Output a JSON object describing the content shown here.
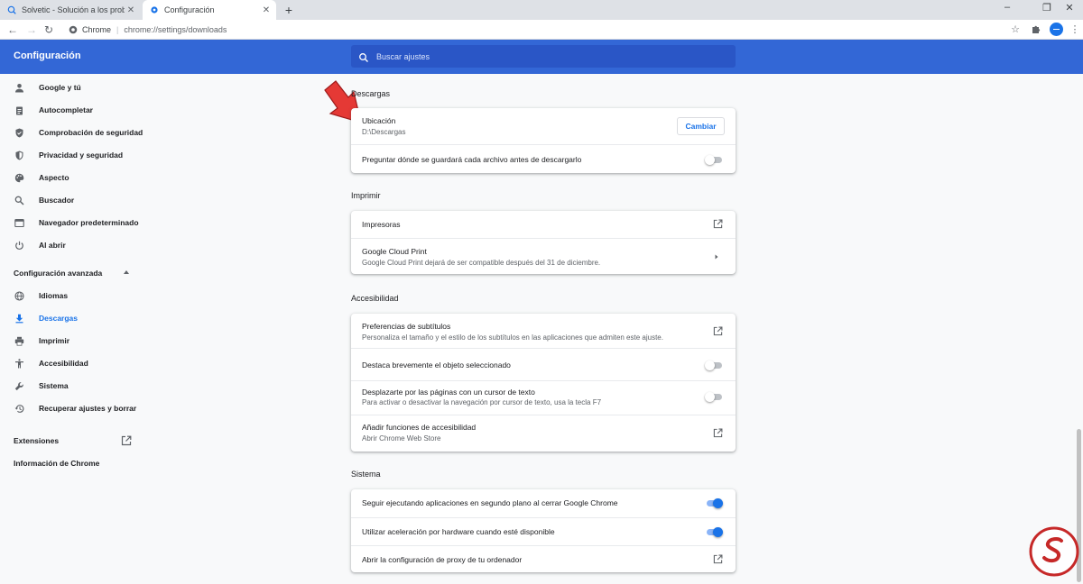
{
  "browser": {
    "tabs": [
      {
        "title": "Solvetic - Solución a los problem",
        "active": false
      },
      {
        "title": "Configuración",
        "active": true
      }
    ],
    "omnibox": {
      "site": "Chrome",
      "url": "chrome://settings/downloads"
    }
  },
  "header": {
    "title": "Configuración",
    "search_placeholder": "Buscar ajustes"
  },
  "sidebar": {
    "items": [
      {
        "label": "Google y tú",
        "icon": "person-icon"
      },
      {
        "label": "Autocompletar",
        "icon": "clipboard-icon"
      },
      {
        "label": "Comprobación de seguridad",
        "icon": "shield-check-icon"
      },
      {
        "label": "Privacidad y seguridad",
        "icon": "shield-icon"
      },
      {
        "label": "Aspecto",
        "icon": "palette-icon"
      },
      {
        "label": "Buscador",
        "icon": "search-icon"
      },
      {
        "label": "Navegador predeterminado",
        "icon": "browser-icon"
      },
      {
        "label": "Al abrir",
        "icon": "power-icon"
      }
    ],
    "advanced_label": "Configuración avanzada",
    "advanced_items": [
      {
        "label": "Idiomas",
        "icon": "globe-icon"
      },
      {
        "label": "Descargas",
        "icon": "download-icon"
      },
      {
        "label": "Imprimir",
        "icon": "printer-icon"
      },
      {
        "label": "Accesibilidad",
        "icon": "accessibility-icon"
      },
      {
        "label": "Sistema",
        "icon": "wrench-icon"
      },
      {
        "label": "Recuperar ajustes y borrar",
        "icon": "history-icon"
      }
    ],
    "extensions_label": "Extensiones",
    "about_label": "Información de Chrome"
  },
  "sections": {
    "downloads": {
      "title": "Descargas",
      "location_label": "Ubicación",
      "location_value": "D:\\Descargas",
      "change_button": "Cambiar",
      "ask_label": "Preguntar dónde se guardará cada archivo antes de descargarlo",
      "ask_enabled": false
    },
    "print": {
      "title": "Imprimir",
      "printers_label": "Impresoras",
      "cloud_label": "Google Cloud Print",
      "cloud_sub": "Google Cloud Print dejará de ser compatible después del 31 de diciembre."
    },
    "accessibility": {
      "title": "Accesibilidad",
      "captions_label": "Preferencias de subtítulos",
      "captions_sub": "Personaliza el tamaño y el estilo de los subtítulos en las aplicaciones que admiten este ajuste.",
      "highlight_label": "Destaca brevemente el objeto seleccionado",
      "highlight_enabled": false,
      "caret_label": "Desplazarte por las páginas con un cursor de texto",
      "caret_sub": "Para activar o desactivar la navegación por cursor de texto, usa la tecla F7",
      "caret_enabled": false,
      "add_label": "Añadir funciones de accesibilidad",
      "add_sub": "Abrir Chrome Web Store"
    },
    "system": {
      "title": "Sistema",
      "background_label": "Seguir ejecutando aplicaciones en segundo plano al cerrar Google Chrome",
      "background_enabled": true,
      "hardware_label": "Utilizar aceleración por hardware cuando esté disponible",
      "hardware_enabled": true,
      "proxy_label": "Abrir la configuración de proxy de tu ordenador"
    }
  },
  "colors": {
    "header": "#3367d6",
    "accent": "#1a73e8",
    "annotation_arrow": "#e53935"
  }
}
